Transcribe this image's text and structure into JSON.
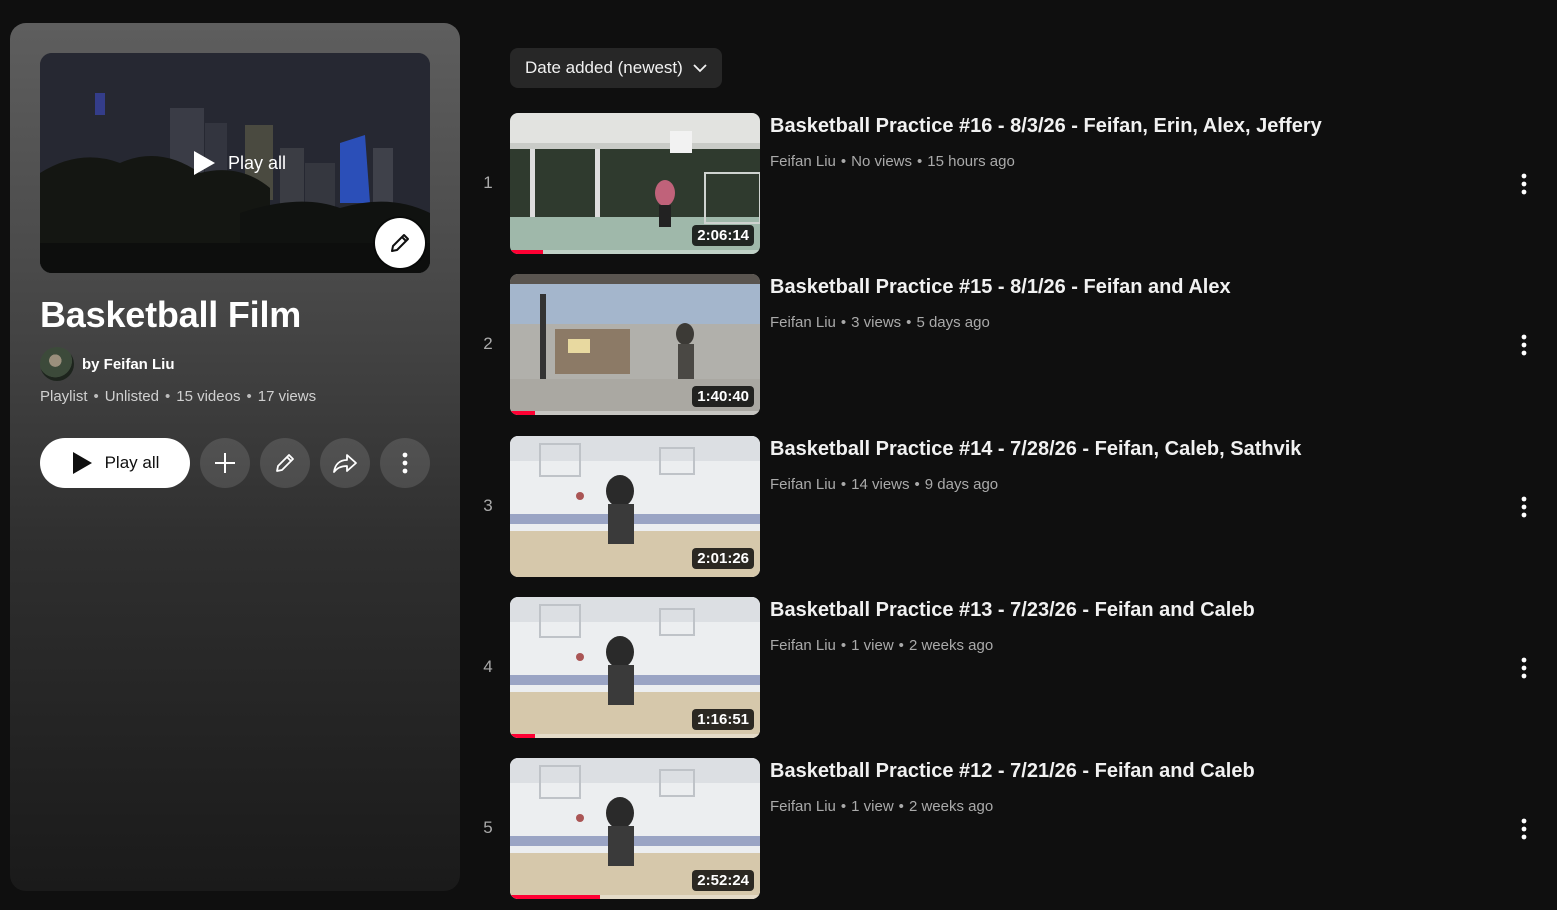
{
  "playlist": {
    "cover_play_label": "Play all",
    "title": "Basketball Film",
    "owner": "by Feifan Liu",
    "meta": [
      "Playlist",
      "Unlisted",
      "15 videos",
      "17 views"
    ],
    "play_all_label": "Play all",
    "buttons": [
      "plus-icon",
      "pencil-icon",
      "share-icon",
      "more-vert-icon"
    ]
  },
  "sort": {
    "label": "Date added (newest)"
  },
  "colors": {
    "background": "#0f0f0f",
    "progress": "#ff0033",
    "chip": "#272727"
  },
  "videos": [
    {
      "index": "1",
      "title": "Basketball Practice #16 - 8/3/26 - Feifan, Erin, Alex, Jeffery",
      "channel": "Feifan Liu",
      "views": "No views",
      "age": "15 hours ago",
      "duration": "2:06:14",
      "watched": 0.13,
      "scene": "outdoor"
    },
    {
      "index": "2",
      "title": "Basketball Practice #15 - 8/1/26 - Feifan and Alex",
      "channel": "Feifan Liu",
      "views": "3 views",
      "age": "5 days ago",
      "duration": "1:40:40",
      "watched": 0.1,
      "scene": "pavilion"
    },
    {
      "index": "3",
      "title": "Basketball Practice #14 - 7/28/26 - Feifan, Caleb, Sathvik",
      "channel": "Feifan Liu",
      "views": "14 views",
      "age": "9 days ago",
      "duration": "2:01:26",
      "watched": 0,
      "scene": "gym"
    },
    {
      "index": "4",
      "title": "Basketball Practice #13 - 7/23/26 - Feifan and Caleb",
      "channel": "Feifan Liu",
      "views": "1 view",
      "age": "2 weeks ago",
      "duration": "1:16:51",
      "watched": 0.1,
      "scene": "gym"
    },
    {
      "index": "5",
      "title": "Basketball Practice #12 - 7/21/26 - Feifan and Caleb",
      "channel": "Feifan Liu",
      "views": "1 view",
      "age": "2 weeks ago",
      "duration": "2:52:24",
      "watched": 0.36,
      "scene": "gym"
    }
  ]
}
